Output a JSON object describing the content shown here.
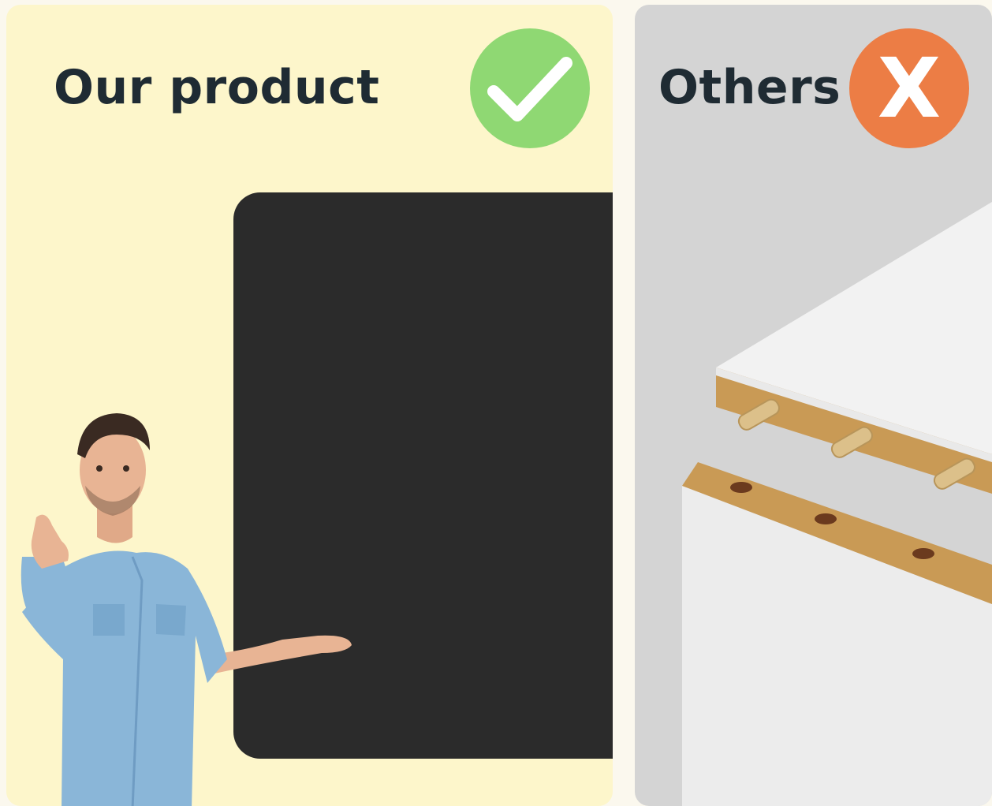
{
  "left_panel": {
    "title": "Our product",
    "badge_icon": "checkmark-icon",
    "badge_color": "#8fd873",
    "board_color": "#2b2b2b",
    "background": "#fdf6cb"
  },
  "right_panel": {
    "title": "Others",
    "badge_icon": "x-icon",
    "badge_text": "X",
    "badge_color": "#ec7d45",
    "background": "#d4d4d4"
  }
}
